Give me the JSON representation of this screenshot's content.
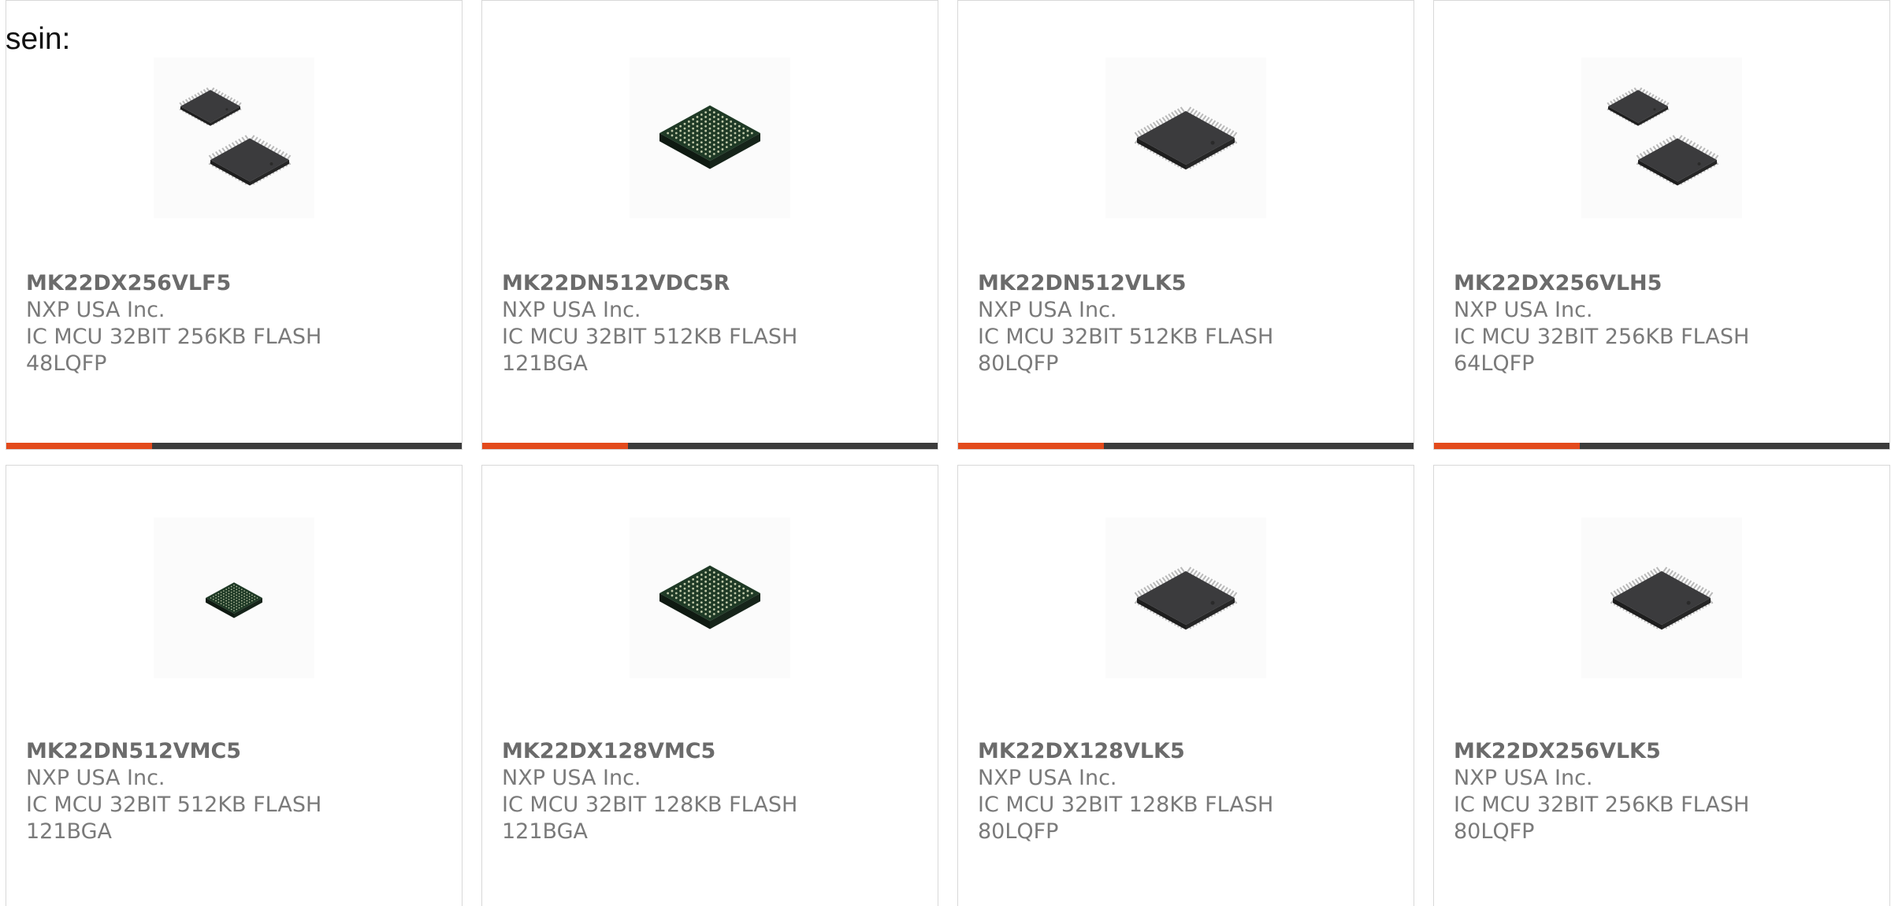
{
  "intro_text": "sein:",
  "accent_color": "#e34a1c",
  "bar_color": "#3c3c3c",
  "products": [
    {
      "part": "MK22DX256VLF5",
      "maker": "NXP USA Inc.",
      "desc_line1": "IC MCU 32BIT 256KB FLASH",
      "desc_line2": "48LQFP",
      "image": "dual-lqfp-chip-icon",
      "bar_fill": 0.32
    },
    {
      "part": "MK22DN512VDC5R",
      "maker": "NXP USA Inc.",
      "desc_line1": "IC MCU 32BIT 512KB FLASH",
      "desc_line2": "121BGA",
      "image": "bga-chip-icon",
      "bar_fill": 0.32
    },
    {
      "part": "MK22DN512VLK5",
      "maker": "NXP USA Inc.",
      "desc_line1": "IC MCU 32BIT 512KB FLASH",
      "desc_line2": "80LQFP",
      "image": "lqfp-chip-icon",
      "bar_fill": 0.32
    },
    {
      "part": "MK22DX256VLH5",
      "maker": "NXP USA Inc.",
      "desc_line1": "IC MCU 32BIT 256KB FLASH",
      "desc_line2": "64LQFP",
      "image": "dual-lqfp-chip-icon",
      "bar_fill": 0.32
    },
    {
      "part": "MK22DN512VMC5",
      "maker": "NXP USA Inc.",
      "desc_line1": "IC MCU 32BIT 512KB FLASH",
      "desc_line2": "121BGA",
      "image": "small-bga-chip-icon"
    },
    {
      "part": "MK22DX128VMC5",
      "maker": "NXP USA Inc.",
      "desc_line1": "IC MCU 32BIT 128KB FLASH",
      "desc_line2": "121BGA",
      "image": "bga-chip-icon"
    },
    {
      "part": "MK22DX128VLK5",
      "maker": "NXP USA Inc.",
      "desc_line1": "IC MCU 32BIT 128KB FLASH",
      "desc_line2": "80LQFP",
      "image": "lqfp-chip-icon"
    },
    {
      "part": "MK22DX256VLK5",
      "maker": "NXP USA Inc.",
      "desc_line1": "IC MCU 32BIT 256KB FLASH",
      "desc_line2": "80LQFP",
      "image": "lqfp-chip-icon"
    }
  ]
}
